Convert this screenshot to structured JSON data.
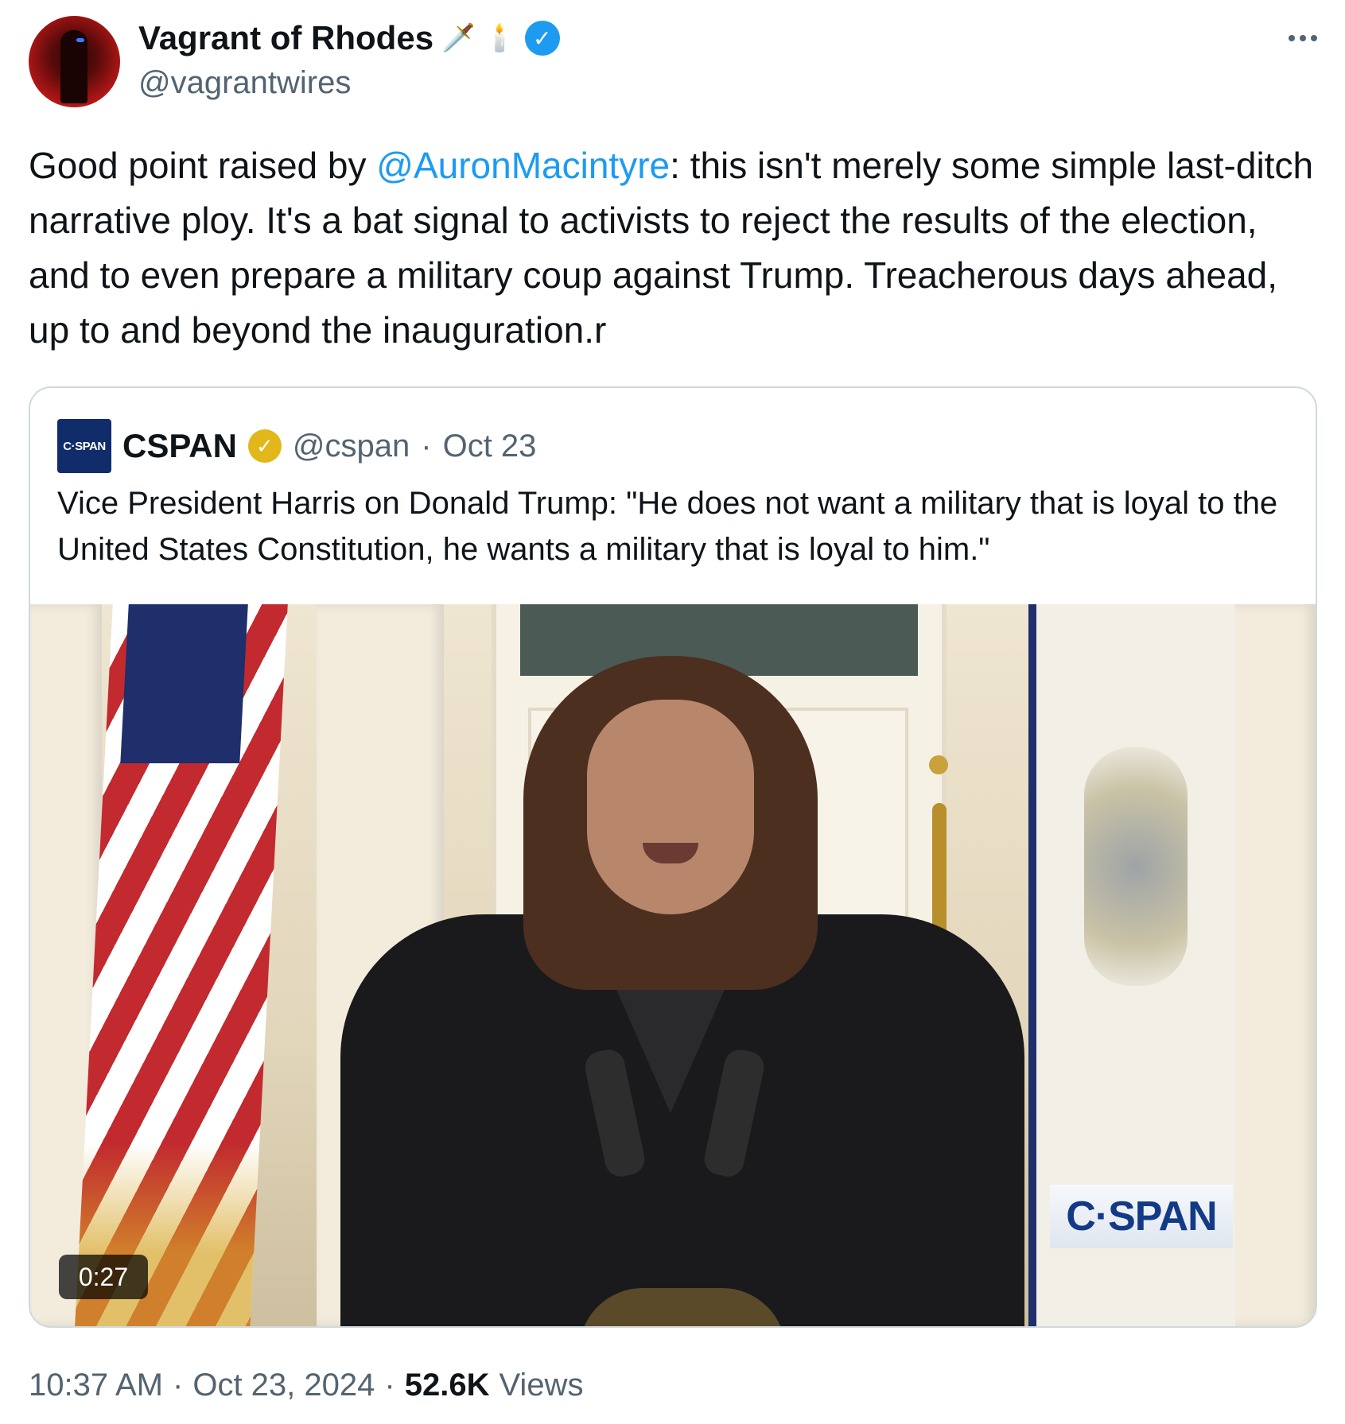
{
  "author": {
    "display_name": "Vagrant of Rhodes",
    "emojis": [
      "🗡️",
      "🕯️"
    ],
    "handle": "@vagrantwires",
    "verified_color": "#1d9bf0"
  },
  "more_button": {
    "icon": "more-dots-icon"
  },
  "tweet": {
    "text_before": "Good point raised by ",
    "mention": "@AuronMacintyre",
    "text_after": ": this isn't merely some simple last-ditch narrative ploy. It's a bat signal to activists to reject the results of the election, and to even prepare a military coup against Trump. Treacherous days ahead, up to and beyond the inauguration.r"
  },
  "quote": {
    "logo_text": "C·SPAN",
    "name": "CSPAN",
    "verified_color": "#e2b719",
    "handle": "@cspan",
    "separator": "·",
    "date": "Oct 23",
    "text": "Vice President Harris on Donald Trump: \"He does not want a military that is loyal to the United States Constitution, he wants a military that is loyal to him.\"",
    "video": {
      "duration": "0:27",
      "watermark": "C·SPAN"
    }
  },
  "footer": {
    "time": "10:37 AM",
    "sep1": "·",
    "date": "Oct 23, 2024",
    "sep2": "·",
    "views_count": "52.6K",
    "views_label": "Views"
  },
  "colors": {
    "accent": "#1d9bf0",
    "text": "#0f1419",
    "muted": "#536471",
    "border": "#cfd9de"
  }
}
